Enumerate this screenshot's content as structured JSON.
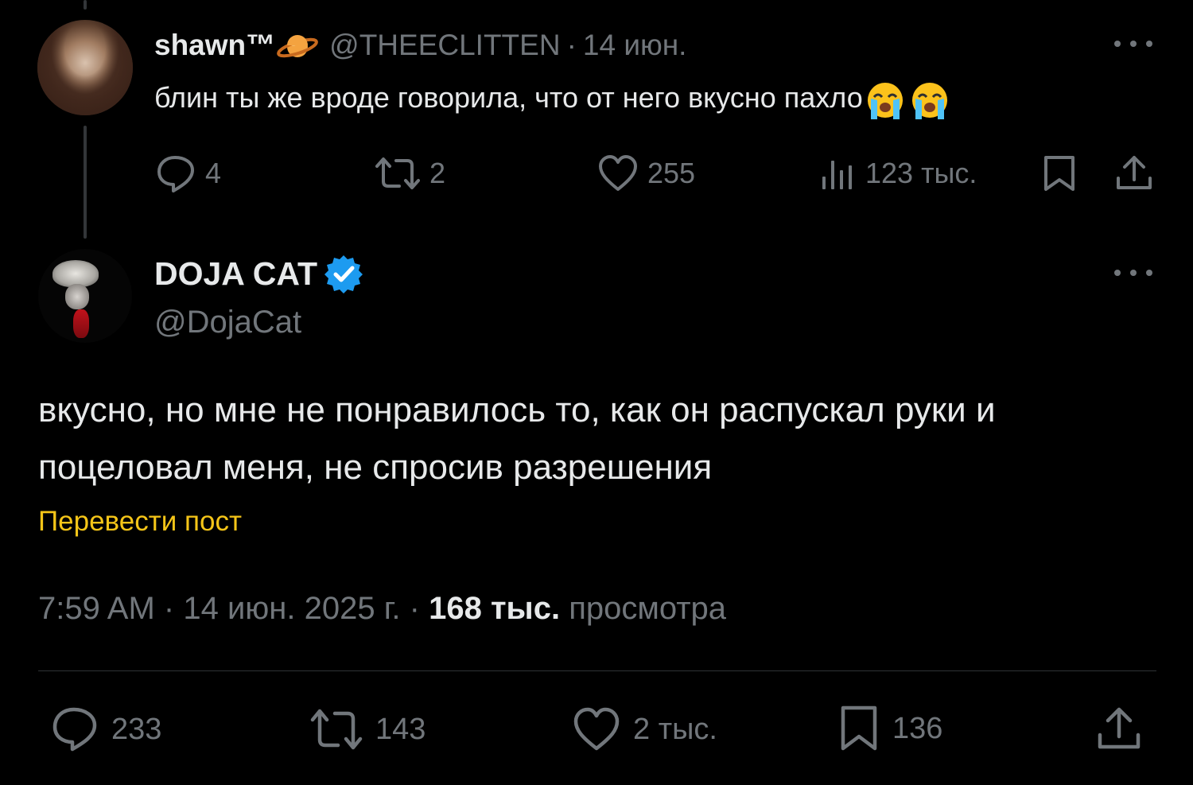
{
  "reply_tweet": {
    "author_name": "shawn™",
    "author_emoji": "ringed-planet-emoji",
    "handle": "@THEECLITTEN",
    "separator": "·",
    "date": "14 июн.",
    "text": "блин ты же вроде говорила, что от него вкусно пахло",
    "text_emoji": [
      "loudly-crying-face-emoji",
      "loudly-crying-face-emoji"
    ],
    "stats": {
      "replies": "4",
      "reposts": "2",
      "likes": "255",
      "views": "123 тыс."
    }
  },
  "main_tweet": {
    "author_name": "DOJA CAT",
    "verified": true,
    "handle": "@DojaCat",
    "text": "вкусно, но мне не понравилось то, как он распускал руки и поцеловал меня, не спросив разрешения",
    "translate_label": "Перевести пост",
    "time": "7:59 AM",
    "separator": "·",
    "date": "14 июн. 2025 г.",
    "views_count": "168 тыс.",
    "views_label": "просмотра",
    "stats": {
      "replies": "233",
      "reposts": "143",
      "likes": "2 тыс.",
      "bookmarks": "136"
    }
  },
  "colors": {
    "background": "#000000",
    "text_primary": "#e7e9ea",
    "text_secondary": "#71767b",
    "translate_link": "#f5c518",
    "verified_badge": "#1d9bf0",
    "divider": "#2f3336"
  }
}
